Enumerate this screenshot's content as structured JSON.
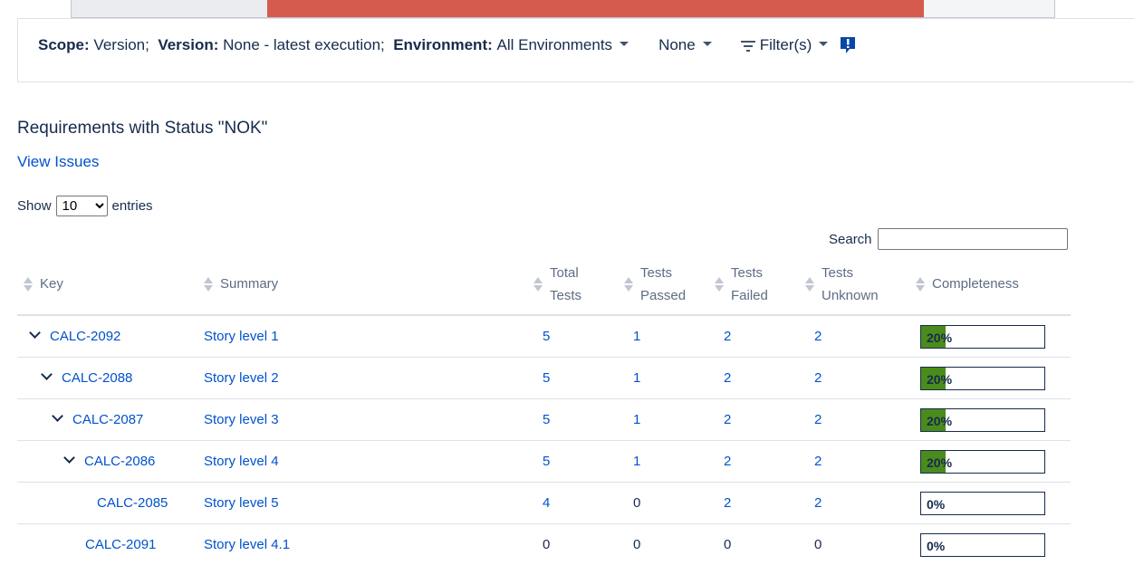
{
  "colors": {
    "bar_red": "#d65b4f",
    "bar_gray": "#ebecf0",
    "progress_fill": "#4a8c1c",
    "link": "#0052cc"
  },
  "scope": {
    "scope_label": "Scope:",
    "scope_value": "Version;",
    "version_label": "Version:",
    "version_value": "None - latest execution;",
    "env_label": "Environment:",
    "env_value": "All Environments",
    "none_dropdown": "None",
    "filter_label": "Filter(s)",
    "icons": {
      "filter": "filter-icon",
      "feedback": "feedback-icon"
    }
  },
  "section": {
    "title": "Requirements with Status \"NOK\"",
    "view_issues": "View Issues"
  },
  "length": {
    "show": "Show",
    "value": "10",
    "entries": "entries"
  },
  "search": {
    "label": "Search",
    "value": ""
  },
  "table": {
    "headers": {
      "key": "Key",
      "summary": "Summary",
      "total_1": "Total",
      "total_2": "Tests",
      "passed_1": "Tests",
      "passed_2": "Passed",
      "failed_1": "Tests",
      "failed_2": "Failed",
      "unknown_1": "Tests",
      "unknown_2": "Unknown",
      "completeness": "Completeness"
    },
    "rows": [
      {
        "key": "CALC-2092",
        "summary": "Story level 1",
        "total": "5",
        "passed": "1",
        "failed": "2",
        "unknown": "2",
        "completeness": "20%",
        "pct": 20
      },
      {
        "key": "CALC-2088",
        "summary": "Story level 2",
        "total": "5",
        "passed": "1",
        "failed": "2",
        "unknown": "2",
        "completeness": "20%",
        "pct": 20
      },
      {
        "key": "CALC-2087",
        "summary": "Story level 3",
        "total": "5",
        "passed": "1",
        "failed": "2",
        "unknown": "2",
        "completeness": "20%",
        "pct": 20
      },
      {
        "key": "CALC-2086",
        "summary": "Story level 4",
        "total": "5",
        "passed": "1",
        "failed": "2",
        "unknown": "2",
        "completeness": "20%",
        "pct": 20
      },
      {
        "key": "CALC-2085",
        "summary": "Story level 5",
        "total": "4",
        "passed": "0",
        "failed": "2",
        "unknown": "2",
        "completeness": "0%",
        "pct": 0
      },
      {
        "key": "CALC-2091",
        "summary": "Story level 4.1",
        "total": "0",
        "passed": "0",
        "failed": "0",
        "unknown": "0",
        "completeness": "0%",
        "pct": 0
      }
    ]
  }
}
